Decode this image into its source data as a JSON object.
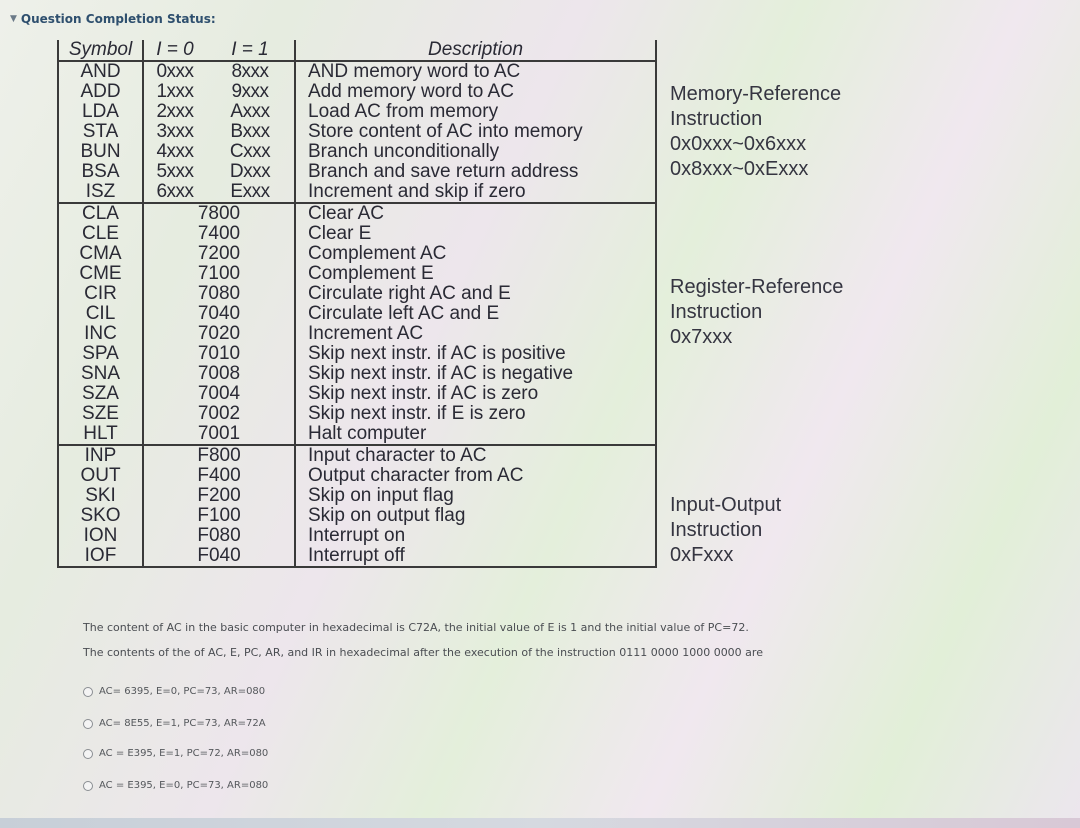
{
  "status": {
    "icon": "chevron-down-icon",
    "label": "Question Completion Status:"
  },
  "table": {
    "headers": {
      "symbol": "Symbol",
      "i0": "I = 0",
      "i1": "I = 1",
      "description": "Description"
    },
    "memory_reference": [
      {
        "symbol": "AND",
        "i0": "0xxx",
        "i1": "8xxx",
        "description": "AND memory word to AC"
      },
      {
        "symbol": "ADD",
        "i0": "1xxx",
        "i1": "9xxx",
        "description": "Add memory word to AC"
      },
      {
        "symbol": "LDA",
        "i0": "2xxx",
        "i1": "Axxx",
        "description": "Load AC from memory"
      },
      {
        "symbol": "STA",
        "i0": "3xxx",
        "i1": "Bxxx",
        "description": "Store content of AC into memory"
      },
      {
        "symbol": "BUN",
        "i0": "4xxx",
        "i1": "Cxxx",
        "description": "Branch unconditionally"
      },
      {
        "symbol": "BSA",
        "i0": "5xxx",
        "i1": "Dxxx",
        "description": "Branch and save return address"
      },
      {
        "symbol": "ISZ",
        "i0": "6xxx",
        "i1": "Exxx",
        "description": "Increment and skip if zero"
      }
    ],
    "register_reference": [
      {
        "symbol": "CLA",
        "code": "7800",
        "description": "Clear AC"
      },
      {
        "symbol": "CLE",
        "code": "7400",
        "description": "Clear E"
      },
      {
        "symbol": "CMA",
        "code": "7200",
        "description": "Complement AC"
      },
      {
        "symbol": "CME",
        "code": "7100",
        "description": "Complement E"
      },
      {
        "symbol": "CIR",
        "code": "7080",
        "description": "Circulate right AC and E"
      },
      {
        "symbol": "CIL",
        "code": "7040",
        "description": "Circulate left AC and E"
      },
      {
        "symbol": "INC",
        "code": "7020",
        "description": "Increment AC"
      },
      {
        "symbol": "SPA",
        "code": "7010",
        "description": "Skip next instr. if AC is positive"
      },
      {
        "symbol": "SNA",
        "code": "7008",
        "description": "Skip next instr. if AC is negative"
      },
      {
        "symbol": "SZA",
        "code": "7004",
        "description": "Skip next instr. if AC is zero"
      },
      {
        "symbol": "SZE",
        "code": "7002",
        "description": "Skip next instr. if E is zero"
      },
      {
        "symbol": "HLT",
        "code": "7001",
        "description": "Halt computer"
      }
    ],
    "io": [
      {
        "symbol": "INP",
        "code": "F800",
        "description": "Input character to AC"
      },
      {
        "symbol": "OUT",
        "code": "F400",
        "description": "Output character from AC"
      },
      {
        "symbol": "SKI",
        "code": "F200",
        "description": "Skip on input flag"
      },
      {
        "symbol": "SKO",
        "code": "F100",
        "description": "Skip on output flag"
      },
      {
        "symbol": "ION",
        "code": "F080",
        "description": "Interrupt on"
      },
      {
        "symbol": "IOF",
        "code": "F040",
        "description": "Interrupt off"
      }
    ]
  },
  "notes": {
    "memory": [
      "Memory-Reference",
      "Instruction",
      "0x0xxx~0x6xxx",
      "0x8xxx~0xExxx"
    ],
    "register": [
      "Register-Reference",
      "Instruction",
      "0x7xxx"
    ],
    "io": [
      "Input-Output",
      "Instruction",
      "0xFxxx"
    ]
  },
  "question": {
    "line1": "The content of AC in the basic computer in hexadecimal is C72A, the initial value of E is 1 and the initial value of PC=72.",
    "line2": "The contents of the of AC, E, PC, AR, and IR in hexadecimal after the execution of the instruction 0111  0000  1000  0000 are",
    "options": [
      "AC= 6395, E=0, PC=73, AR=080",
      "AC= 8E55, E=1, PC=73, AR=72A",
      "AC = E395, E=1, PC=72, AR=080",
      "AC = E395, E=0, PC=73, AR=080"
    ]
  }
}
